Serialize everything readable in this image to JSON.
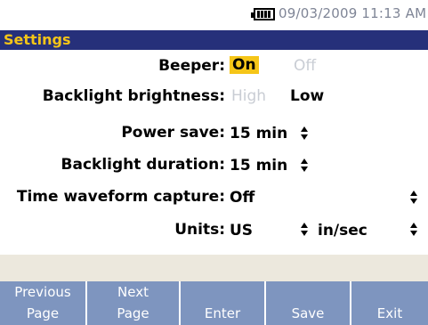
{
  "status": {
    "battery_icon": "battery-full-icon",
    "datetime": "09/03/2009 11:13 AM"
  },
  "title": "Settings",
  "settings": {
    "beeper": {
      "label": "Beeper:",
      "on": "On",
      "off": "Off",
      "selected": "On"
    },
    "backlight_brightness": {
      "label": "Backlight brightness:",
      "high": "High",
      "low": "Low",
      "selected": "Low"
    },
    "power_save": {
      "label": "Power save:",
      "value": "15 min"
    },
    "backlight_duration": {
      "label": "Backlight duration:",
      "value": "15 min"
    },
    "time_waveform_capture": {
      "label": "Time waveform capture:",
      "value": "Off"
    },
    "units": {
      "label": "Units:",
      "system": "US",
      "velocity": "in/sec"
    }
  },
  "softkeys": [
    {
      "line1": "Previous",
      "line2": "Page"
    },
    {
      "line1": "Next",
      "line2": "Page"
    },
    {
      "line1": "",
      "line2": "Enter"
    },
    {
      "line1": "",
      "line2": "Save"
    },
    {
      "line1": "",
      "line2": "Exit"
    }
  ],
  "colors": {
    "title_bar": "#26307a",
    "title_text": "#f5c518",
    "highlight": "#f5c518",
    "softkey_bg": "#7e95bf",
    "disabled_text": "#c9cdd4"
  }
}
